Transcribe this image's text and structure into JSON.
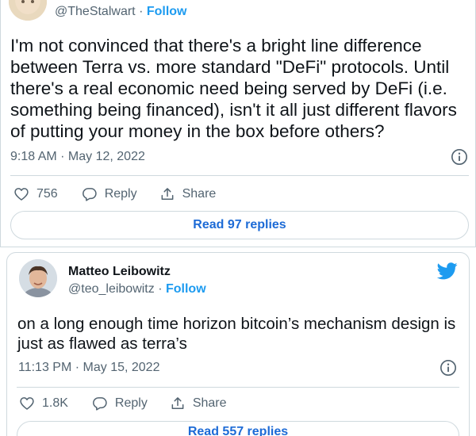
{
  "colors": {
    "accent": "#1d9bf0",
    "link_button": "#1d6bd6",
    "secondary_text": "#536471",
    "border": "#cfd9de"
  },
  "tweet1": {
    "handle": "@TheStalwart",
    "separator": "·",
    "follow": "Follow",
    "text": "I'm not convinced that there's a bright line difference between Terra vs. more standard \"DeFi\" protocols. Until there's a real economic need being served by DeFi (i.e. something being financed), isn't it all just different flavors of putting your money in the box before others?",
    "timestamp": "9:18 AM · May 12, 2022",
    "info_icon": "info-icon",
    "likes": "756",
    "reply_label": "Reply",
    "share_label": "Share",
    "read_replies": "Read 97 replies"
  },
  "tweet2": {
    "name": "Matteo Leibowitz",
    "handle": "@teo_leibowitz",
    "separator": "·",
    "follow": "Follow",
    "text": "on a long enough time horizon bitcoin’s mechanism design is just as flawed as terra’s",
    "timestamp": "11:13 PM · May 15, 2022",
    "info_icon": "info-icon",
    "likes": "1.8K",
    "reply_label": "Reply",
    "share_label": "Share",
    "read_replies": "Read 557 replies",
    "brand_icon": "twitter-bird-icon"
  }
}
